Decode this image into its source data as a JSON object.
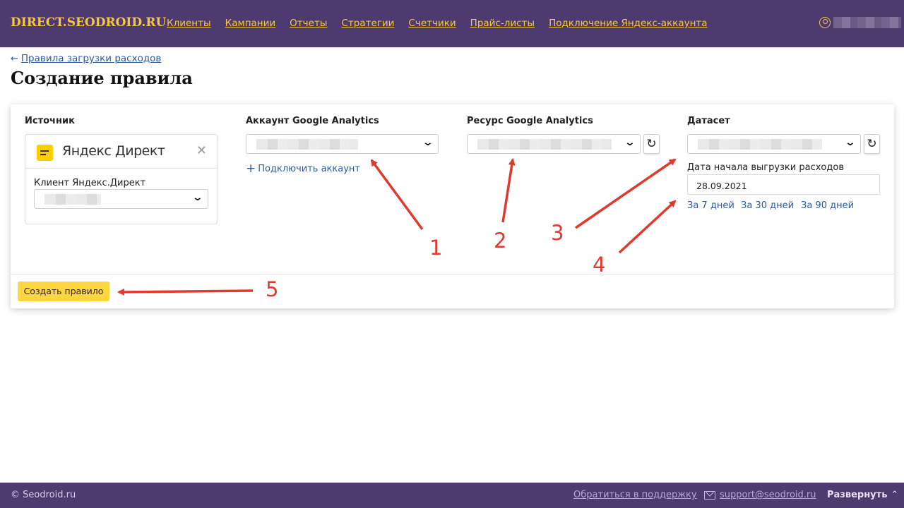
{
  "header": {
    "brand": "DIRECT.SEODROID.RU",
    "nav": [
      "Клиенты",
      "Кампании",
      "Отчеты",
      "Стратегии",
      "Счетчики",
      "Прайс-листы",
      "Подключение Яндекс-аккаунта"
    ],
    "user_icon": "user-circle-icon"
  },
  "breadcrumb": {
    "arrow": "←",
    "label": "Правила загрузки расходов"
  },
  "page_title": "Создание правила",
  "form": {
    "source": {
      "label": "Источник",
      "brand": "Яндекс Директ",
      "close": "✕",
      "client_label": "Клиент Яндекс.Директ"
    },
    "ga_account": {
      "label": "Аккаунт Google Analytics",
      "add_label": "Подключить аккаунт"
    },
    "ga_resource": {
      "label": "Ресурс Google Analytics"
    },
    "dataset": {
      "label": "Датасет",
      "date_label": "Дата начала выгрузки расходов",
      "date_value": "28.09.2021",
      "quick": [
        "За 7 дней",
        "За 30 дней",
        "За 90 дней"
      ]
    },
    "submit": "Создать правило"
  },
  "annotations": {
    "color": "#e03a2f",
    "numbers": [
      "1",
      "2",
      "3",
      "4",
      "5"
    ]
  },
  "footer": {
    "copyright": "© Seodroid.ru",
    "support": "Обратиться в поддержку",
    "email": "support@seodroid.ru",
    "expand": "Развернуть",
    "expand_caret": "⌃"
  },
  "colors": {
    "header_bg": "#4d3a6f",
    "brand": "#f5c842",
    "link": "#2b5b9c",
    "button": "#ffd640"
  }
}
